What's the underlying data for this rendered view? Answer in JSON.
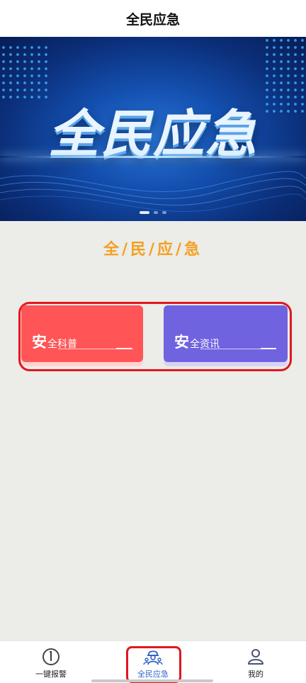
{
  "header": {
    "title": "全民应急"
  },
  "banner": {
    "title": "全民应急",
    "pager": {
      "count": 3,
      "active": 0
    }
  },
  "section": {
    "title": "全/民/应/急"
  },
  "cards": [
    {
      "big": "安",
      "small": "全科普",
      "color": "#ff5556"
    },
    {
      "big": "安",
      "small": "全资讯",
      "color": "#6f63e0"
    }
  ],
  "bottom_nav": {
    "items": [
      {
        "label": "一键报警",
        "icon": "alarm-clock-icon"
      },
      {
        "label": "全民应急",
        "icon": "people-emergency-icon",
        "active": true
      },
      {
        "label": "我的",
        "icon": "user-icon"
      }
    ],
    "active_color": "#2c63c9"
  },
  "highlight_color": "#e0171f"
}
